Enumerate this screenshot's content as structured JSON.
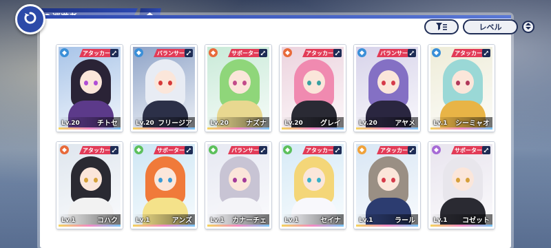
{
  "header": {
    "title": "巡遊者"
  },
  "controls": {
    "sort_label": "レベル"
  },
  "characters": [
    {
      "name": "チトセ",
      "level": "Lv.20",
      "role": "アタッカー",
      "element": "water",
      "role_color": "#e23b57",
      "elem_color": "#3a8fd8",
      "bg": "#a8c4e8",
      "hair": "#2a2336",
      "outfit": "#5c3a8a",
      "eye": "#b04dd6"
    },
    {
      "name": "フリージア",
      "level": "Lv.20",
      "role": "バランサー",
      "element": "water",
      "role_color": "#e23b57",
      "elem_color": "#3a8fd8",
      "bg": "#8fa4c8",
      "hair": "#e8ecf4",
      "outfit": "#2c3048",
      "eye": "#d63a3a"
    },
    {
      "name": "ナズナ",
      "level": "Lv.20",
      "role": "サポーター",
      "element": "fire",
      "role_color": "#e23b57",
      "elem_color": "#e86a3a",
      "bg": "#c9ead8",
      "hair": "#8fd67a",
      "outfit": "#e8d890",
      "eye": "#c24a8a"
    },
    {
      "name": "グレイ",
      "level": "Lv.20",
      "role": "アタッカー",
      "element": "fire",
      "role_color": "#e23b57",
      "elem_color": "#e86a3a",
      "bg": "#ecd3de",
      "hair": "#f08ab0",
      "outfit": "#2a2a34",
      "eye": "#3aa0a0"
    },
    {
      "name": "アヤメ",
      "level": "Lv.20",
      "role": "バランサー",
      "element": "water",
      "role_color": "#e23b57",
      "elem_color": "#3a8fd8",
      "bg": "#d7d3ea",
      "hair": "#8470c4",
      "outfit": "#2a2640",
      "eye": "#d63a4a"
    },
    {
      "name": "シーミャオ",
      "level": "Lv.1",
      "role": "アタッカー",
      "element": "water",
      "role_color": "#e23b57",
      "elem_color": "#3a8fd8",
      "bg": "#eeecd8",
      "hair": "#9ad8d6",
      "outfit": "#e8b446",
      "eye": "#b0385a"
    },
    {
      "name": "コハク",
      "level": "Lv.1",
      "role": "アタッカー",
      "element": "fire",
      "role_color": "#e23b57",
      "elem_color": "#e86a3a",
      "bg": "#dfe6ee",
      "hair": "#2a2a32",
      "outfit": "#f2f2f2",
      "eye": "#d6a23a"
    },
    {
      "name": "アンズ",
      "level": "Lv.1",
      "role": "サポーター",
      "element": "wind",
      "role_color": "#e23b57",
      "elem_color": "#5cc05c",
      "bg": "#cde6f4",
      "hair": "#f07a3a",
      "outfit": "#f4e28a",
      "eye": "#3a9ad6"
    },
    {
      "name": "カナーチェ",
      "level": "Lv.1",
      "role": "バランサー",
      "element": "wind",
      "role_color": "#e23b57",
      "elem_color": "#5cc05c",
      "bg": "#e6e8f2",
      "hair": "#c8c4d4",
      "outfit": "#f4f4f8",
      "eye": "#a43a9a"
    },
    {
      "name": "セイナ",
      "level": "Lv.1",
      "role": "アタッカー",
      "element": "wind",
      "role_color": "#e23b57",
      "elem_color": "#5cc05c",
      "bg": "#d6eaf6",
      "hair": "#f4d678",
      "outfit": "#f8f8fc",
      "eye": "#3ab0c8"
    },
    {
      "name": "ラール",
      "level": "Lv.1",
      "role": "アタッカー",
      "element": "light",
      "role_color": "#e23b57",
      "elem_color": "#f0a23a",
      "bg": "#d8e6f4",
      "hair": "#9a8f84",
      "outfit": "#2c3c70",
      "eye": "#d63a4a"
    },
    {
      "name": "コゼット",
      "level": "Lv.1",
      "role": "サポーター",
      "element": "dark",
      "role_color": "#e23b57",
      "elem_color": "#a66ad6",
      "bg": "#e8e4ee",
      "hair": "#e8e6ec",
      "outfit": "#2a2a32",
      "eye": "#d6a03a"
    }
  ],
  "icons": {
    "back": "back-arrow-icon",
    "location": "location-pin-icon",
    "home": "home-icon",
    "filter": "filter-icon",
    "order": "sort-order-icon",
    "weapon": "weapon-icon"
  }
}
